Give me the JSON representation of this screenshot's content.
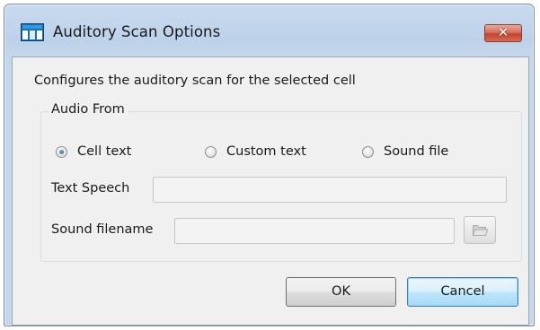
{
  "window": {
    "title": "Auditory Scan Options",
    "close_label": "✕"
  },
  "description": "Configures the auditory scan for the selected cell",
  "audio_from": {
    "group_label": "Audio From",
    "options": [
      {
        "label": "Cell text",
        "checked": true
      },
      {
        "label": "Custom text",
        "checked": false
      },
      {
        "label": "Sound file",
        "checked": false
      }
    ]
  },
  "fields": {
    "text_speech": {
      "label": "Text Speech",
      "value": ""
    },
    "sound_filename": {
      "label": "Sound filename",
      "value": ""
    }
  },
  "buttons": {
    "ok_label": "OK",
    "cancel_label": "Cancel"
  },
  "icons": {
    "app": "app-window-icon",
    "close": "close-icon",
    "browse": "folder-open-icon"
  },
  "colors": {
    "titlebar": "#bdd1ea",
    "close_button": "#c4432f",
    "default_button_border": "#3c7fb1"
  }
}
